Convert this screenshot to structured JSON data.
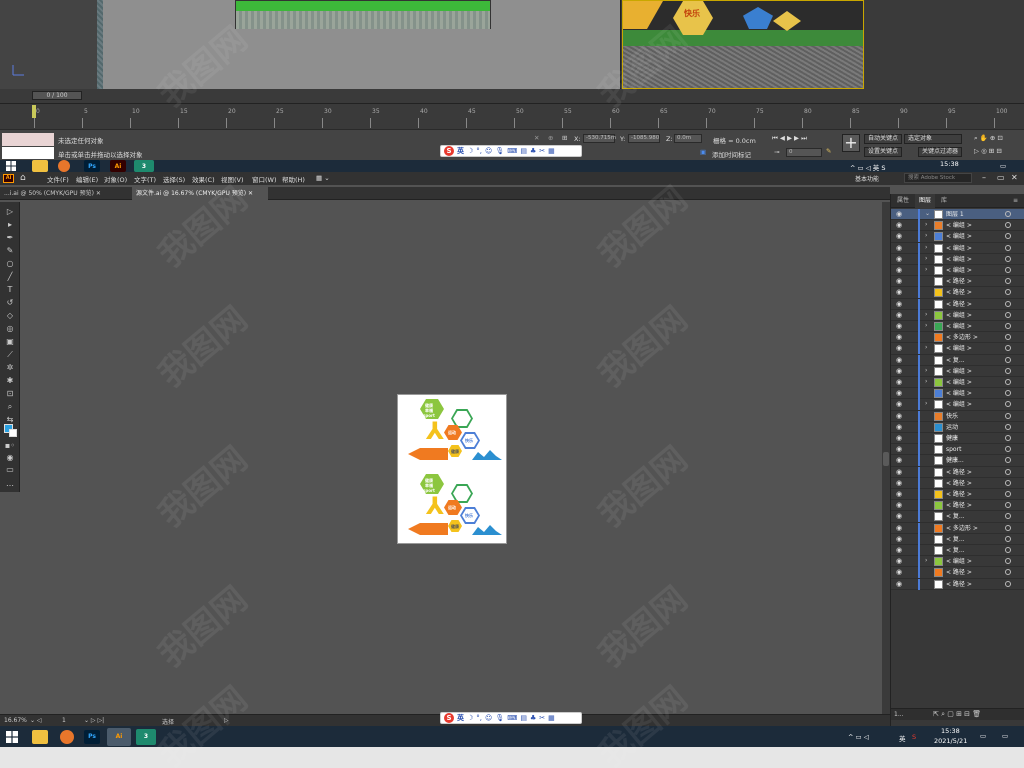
{
  "max": {
    "vp2_hex_label": "快乐",
    "timeline_value": "0 / 100",
    "ruler_ticks": [
      "0",
      "5",
      "10",
      "15",
      "20",
      "25",
      "30",
      "35",
      "40",
      "45",
      "50",
      "55",
      "60",
      "65",
      "70",
      "75",
      "80",
      "85",
      "90",
      "95",
      "100"
    ],
    "status_line1": "未选定任何对象",
    "status_line2": "单击或单击并拖动以选择对象",
    "x_label": "X:",
    "x_value": "-530.715m",
    "y_label": "Y:",
    "y_value": "-1085.980",
    "z_label": "Z:",
    "z_value": "0.0m",
    "grid_label": "栅格 = 0.0cm",
    "add_time_tag": "添加时间标记",
    "auto_key": "自动关键点",
    "set_key": "设置关键点",
    "selected_object": "选定对象",
    "key_filter": "关键点过滤器",
    "frame_value": "0"
  },
  "ime": {
    "logo": "S",
    "mode": "英"
  },
  "taskbar_top": {
    "time": "15:38",
    "lang": "英"
  },
  "taskbar_bottom": {
    "time": "15:38",
    "date": "2021/5/21",
    "lang": "英"
  },
  "ai": {
    "logo": "Ai",
    "menus": [
      "文件(F)",
      "编辑(E)",
      "对象(O)",
      "文字(T)",
      "选择(S)",
      "效果(C)",
      "视图(V)",
      "窗口(W)",
      "帮助(H)"
    ],
    "workspace": "基本功能",
    "search_placeholder": "搜索 Adobe Stock",
    "tabs": [
      "...i.ai @ 50% (CMYK/GPU 预览)",
      "源文件.ai @ 16.67% (CMYK/GPU 预览)"
    ],
    "zoom": "16.67%",
    "page": "1",
    "status_tool": "选择",
    "artboard": {
      "top_texts": [
        "健康",
        "幸福",
        "sport",
        "运动",
        "快乐",
        "健康"
      ],
      "bottom_texts": [
        "健康",
        "幸福",
        "sport",
        "运动",
        "快乐",
        "健康"
      ]
    },
    "panel": {
      "tabs": [
        "属性",
        "图层",
        "库"
      ],
      "rows": [
        {
          "name": "图层 1",
          "top": true
        },
        {
          "name": "< 编组 >",
          "exp": true
        },
        {
          "name": "< 编组 >",
          "exp": true
        },
        {
          "name": "< 编组 >",
          "exp": true
        },
        {
          "name": "< 编组 >",
          "exp": true
        },
        {
          "name": "< 编组 >",
          "exp": true
        },
        {
          "name": "< 路径 >"
        },
        {
          "name": "< 路径 >"
        },
        {
          "name": "< 路径 >"
        },
        {
          "name": "< 编组 >",
          "exp": true
        },
        {
          "name": "< 编组 >",
          "exp": true
        },
        {
          "name": "< 多边形 >"
        },
        {
          "name": "< 编组 >",
          "exp": true
        },
        {
          "name": "< 复..."
        },
        {
          "name": "< 编组 >",
          "exp": true
        },
        {
          "name": "< 编组 >",
          "exp": true
        },
        {
          "name": "< 编组 >"
        },
        {
          "name": "< 编组 >",
          "exp": true
        },
        {
          "name": "快乐"
        },
        {
          "name": "运动"
        },
        {
          "name": "健康"
        },
        {
          "name": "sport"
        },
        {
          "name": "健康..."
        },
        {
          "name": "< 路径 >"
        },
        {
          "name": "< 路径 >"
        },
        {
          "name": "< 路径 >"
        },
        {
          "name": "< 路径 >"
        },
        {
          "name": "< 复..."
        },
        {
          "name": "< 多边形 >"
        },
        {
          "name": "< 复..."
        },
        {
          "name": "< 复..."
        },
        {
          "name": "< 编组 >",
          "exp": true
        },
        {
          "name": "< 路径 >"
        },
        {
          "name": "< 路径 >"
        }
      ],
      "footer": "1..."
    }
  },
  "watermark": "我图网"
}
